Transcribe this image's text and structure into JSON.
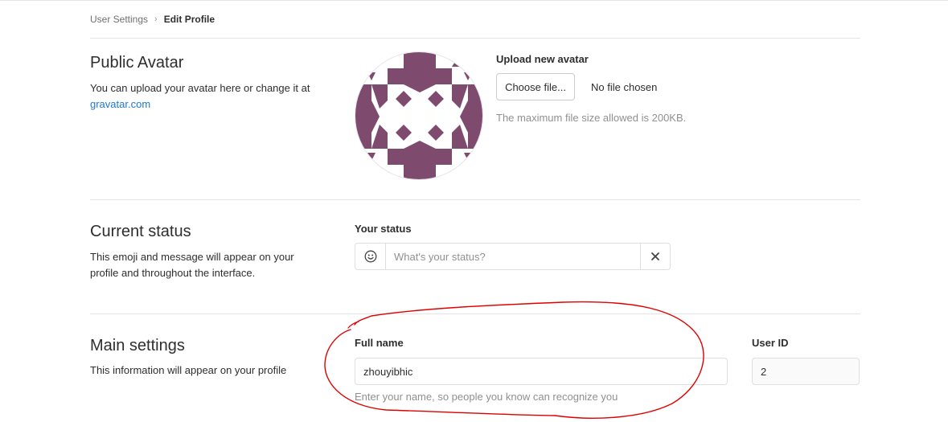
{
  "breadcrumb": {
    "parent": "User Settings",
    "current": "Edit Profile"
  },
  "avatar_section": {
    "title": "Public Avatar",
    "desc_prefix": "You can upload your avatar here or change it at",
    "link": "gravatar.com",
    "upload_label": "Upload new avatar",
    "choose_button": "Choose file...",
    "no_file_text": "No file chosen",
    "help": "The maximum file size allowed is 200KB.",
    "identicon_color": "#7e4a6e"
  },
  "status_section": {
    "title": "Current status",
    "desc": "This emoji and message will appear on your profile and throughout the interface.",
    "label": "Your status",
    "placeholder": "What's your status?",
    "emoji_icon": "smiley-icon",
    "clear_icon": "close-icon"
  },
  "main_section": {
    "title": "Main settings",
    "desc": "This information will appear on your profile",
    "full_name_label": "Full name",
    "full_name_value": "zhouyibhic",
    "full_name_help": "Enter your name, so people you know can recognize you",
    "user_id_label": "User ID",
    "user_id_value": "2"
  },
  "annotation_color": "#e00000"
}
